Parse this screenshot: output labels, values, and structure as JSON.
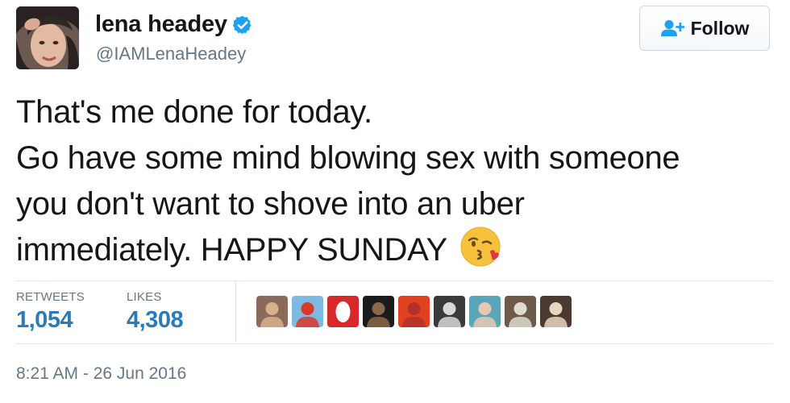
{
  "author": {
    "display_name": "lena headey",
    "handle": "@IAMLenaHeadey",
    "verified": true,
    "avatar_icon": "profile-photo"
  },
  "follow_button": {
    "label": "Follow",
    "icon": "add-user-icon"
  },
  "tweet": {
    "lines": [
      "That's me done for today.",
      "Go have some mind blowing sex with someone",
      "you don't want to shove into an uber",
      "immediately. HAPPY SUNDAY"
    ],
    "emoji": "face-throwing-kiss-emoji"
  },
  "stats": {
    "retweets_label": "RETWEETS",
    "retweets_count": "1,054",
    "likes_label": "LIKES",
    "likes_count": "4,308"
  },
  "likers": [
    {
      "name": "liker-avatar-1",
      "bg": "#8a6a5a",
      "fg": "#d9b08c"
    },
    {
      "name": "liker-avatar-2",
      "bg": "#7fb8e0",
      "fg": "#d83a2a"
    },
    {
      "name": "liker-avatar-3",
      "bg": "#d8282a",
      "fg": "#ffffff"
    },
    {
      "name": "liker-avatar-4",
      "bg": "#1b1b1b",
      "fg": "#8a6848"
    },
    {
      "name": "liker-avatar-5",
      "bg": "#e0421f",
      "fg": "#b0302a"
    },
    {
      "name": "liker-avatar-6",
      "bg": "#3a3a3a",
      "fg": "#d8d8d8"
    },
    {
      "name": "liker-avatar-7",
      "bg": "#5ba5b8",
      "fg": "#e8c8b0"
    },
    {
      "name": "liker-avatar-8",
      "bg": "#6e5a48",
      "fg": "#dcdcd0"
    },
    {
      "name": "liker-avatar-9",
      "bg": "#4a3a32",
      "fg": "#e8d6c0"
    }
  ],
  "timestamp": "8:21 AM - 26 Jun 2016",
  "colors": {
    "link_blue": "#2b7bb9",
    "verified_blue": "#1da1f2",
    "muted_gray": "#657786",
    "divider": "#e1e8ed"
  }
}
